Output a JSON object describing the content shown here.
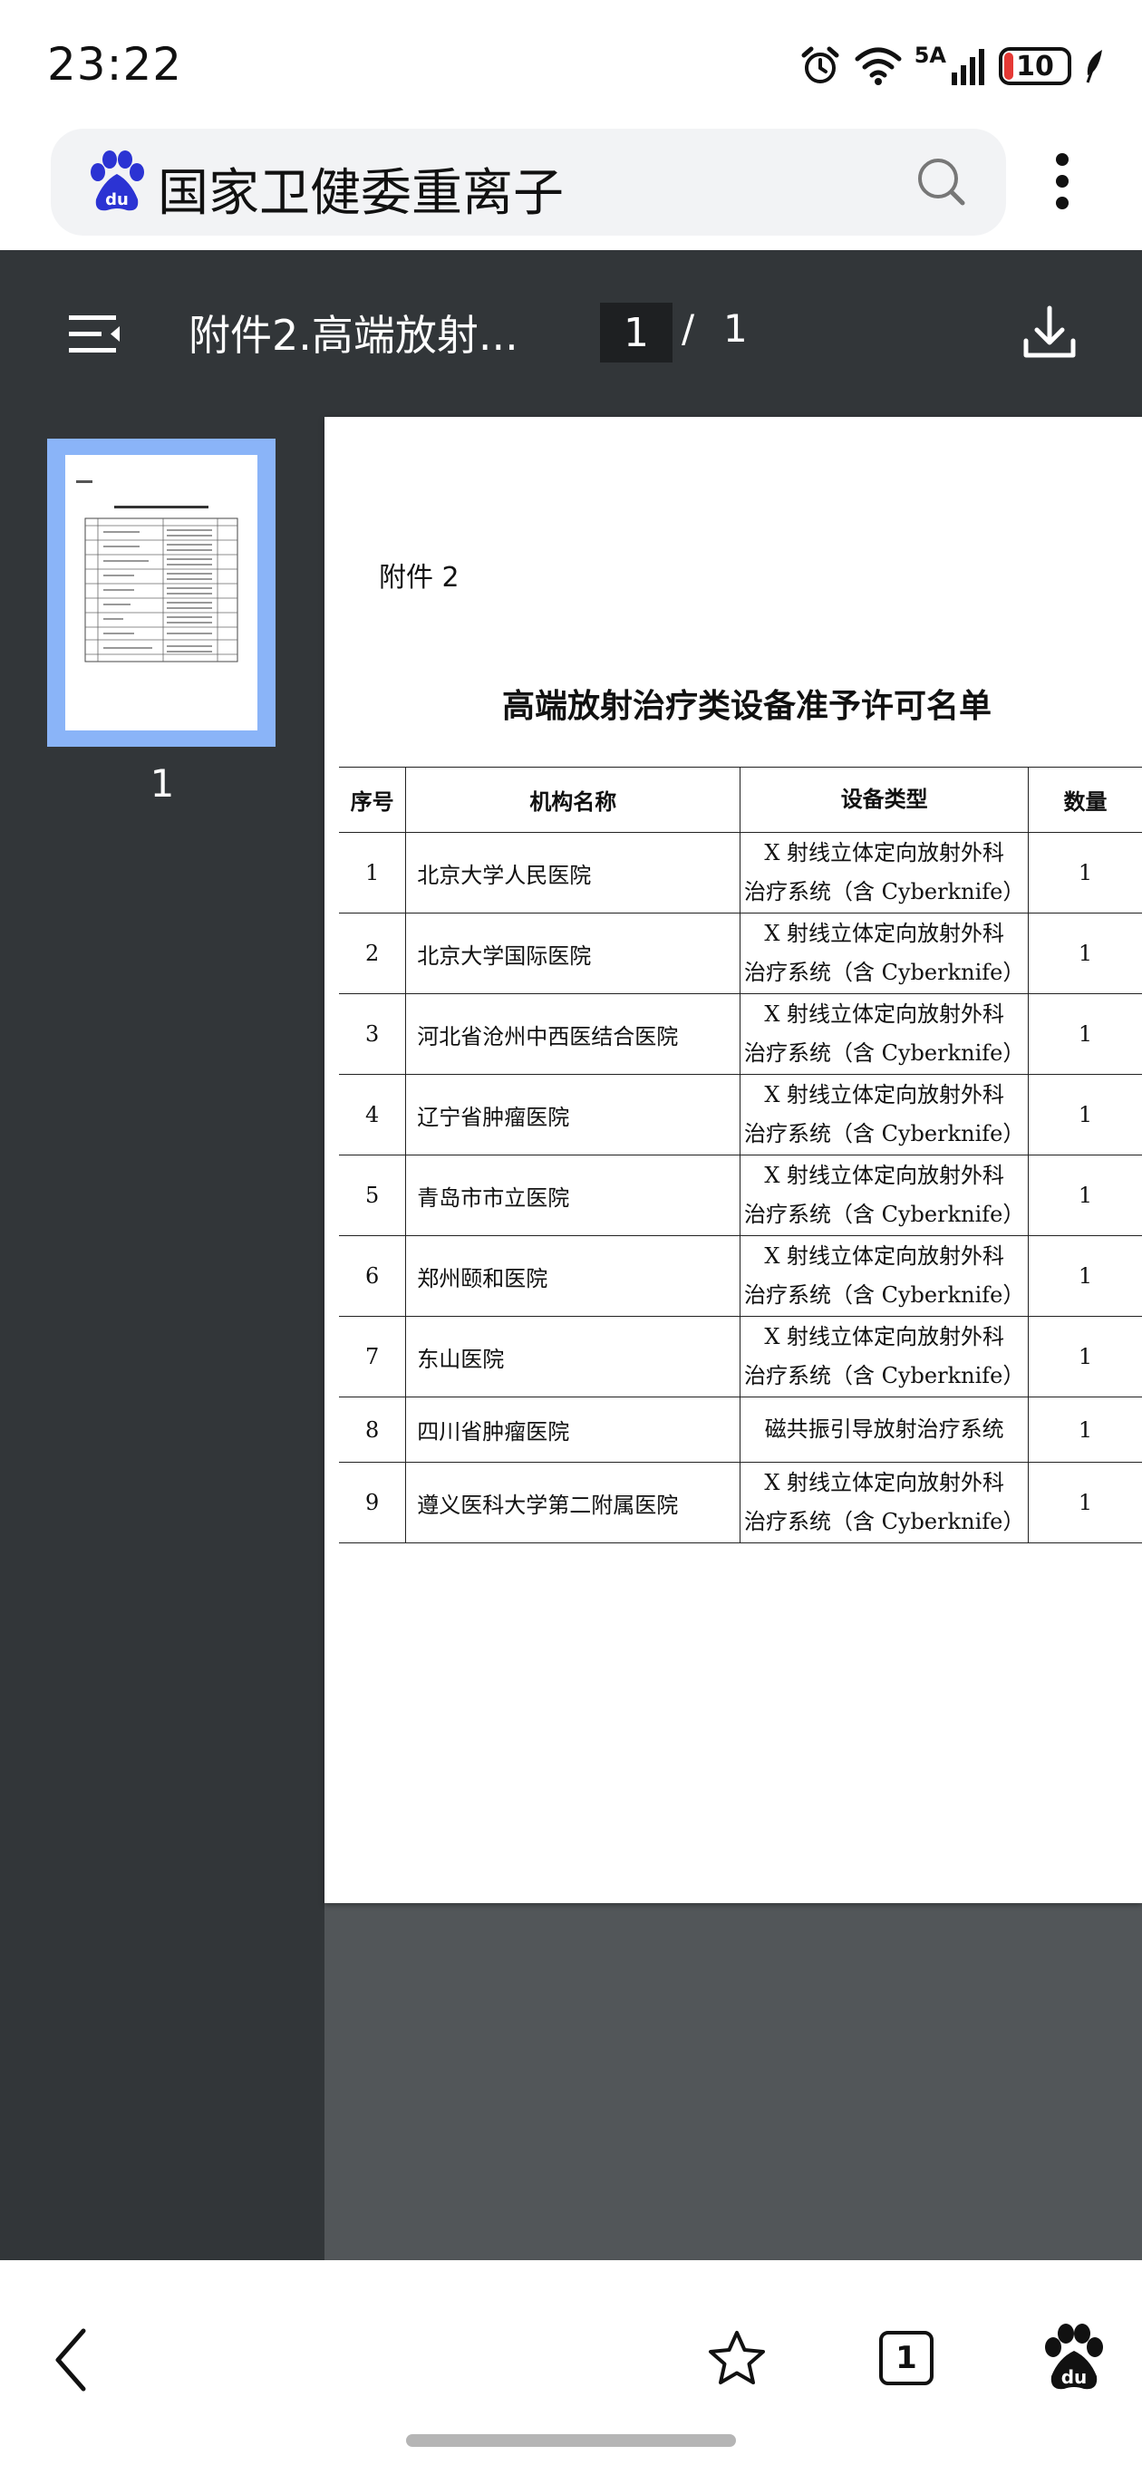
{
  "status_bar": {
    "time": "23:22",
    "network": "5A",
    "battery": "10"
  },
  "search": {
    "query": "国家卫健委重离子"
  },
  "viewer": {
    "title": "附件2.高端放射...",
    "page_current": "1",
    "page_separator": "/",
    "page_total": "1"
  },
  "sidebar": {
    "thumb_number": "1"
  },
  "document": {
    "attachment_label": "附件 2",
    "heading": "高端放射治疗类设备准予许可名单",
    "columns": [
      "序号",
      "机构名称",
      "设备类型",
      "数量"
    ],
    "rows": [
      {
        "seq": "1",
        "name": "北京大学人民医院",
        "type1": "X 射线立体定向放射外科",
        "type2": "治疗系统（含 Cyberknife）",
        "qty": "1"
      },
      {
        "seq": "2",
        "name": "北京大学国际医院",
        "type1": "X 射线立体定向放射外科",
        "type2": "治疗系统（含 Cyberknife）",
        "qty": "1"
      },
      {
        "seq": "3",
        "name": "河北省沧州中西医结合医院",
        "type1": "X 射线立体定向放射外科",
        "type2": "治疗系统（含 Cyberknife）",
        "qty": "1"
      },
      {
        "seq": "4",
        "name": "辽宁省肿瘤医院",
        "type1": "X 射线立体定向放射外科",
        "type2": "治疗系统（含 Cyberknife）",
        "qty": "1"
      },
      {
        "seq": "5",
        "name": "青岛市市立医院",
        "type1": "X 射线立体定向放射外科",
        "type2": "治疗系统（含 Cyberknife）",
        "qty": "1"
      },
      {
        "seq": "6",
        "name": "郑州颐和医院",
        "type1": "X 射线立体定向放射外科",
        "type2": "治疗系统（含 Cyberknife）",
        "qty": "1"
      },
      {
        "seq": "7",
        "name": "东山医院",
        "type1": "X 射线立体定向放射外科",
        "type2": "治疗系统（含 Cyberknife）",
        "qty": "1"
      },
      {
        "seq": "8",
        "name": "四川省肿瘤医院",
        "type1": "磁共振引导放射治疗系统",
        "type2": "",
        "qty": "1"
      },
      {
        "seq": "9",
        "name": "遵义医科大学第二附属医院",
        "type1": "X 射线立体定向放射外科",
        "type2": "治疗系统（含 Cyberknife）",
        "qty": "1"
      }
    ]
  },
  "bottom_nav": {
    "tab_count": "1"
  },
  "colors": {
    "toolbar_bg": "#323639",
    "viewer_bg": "#525659",
    "thumb_highlight": "#8ab4f8",
    "baidu_blue": "#2b33d3",
    "battery_low": "#e53935"
  },
  "icons": [
    "baidu-logo-icon",
    "search-icon",
    "more-vert-icon",
    "menu-icon",
    "download-icon",
    "back-icon",
    "star-icon",
    "tabs-icon",
    "baidu-paw-icon",
    "alarm-icon",
    "wifi-icon",
    "signal-icon",
    "battery-icon",
    "leaf-icon"
  ]
}
